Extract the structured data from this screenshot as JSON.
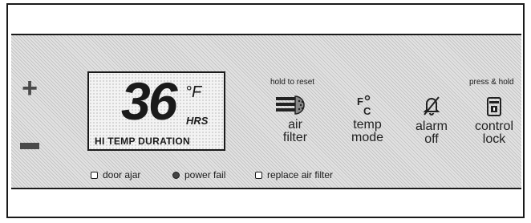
{
  "adjust": {
    "plus": "+"
  },
  "display": {
    "temperature": "36",
    "unit": "°F",
    "hours_unit": "HRS",
    "mode_label": "HI TEMP DURATION"
  },
  "controls": {
    "hold_to_reset": "hold to reset",
    "press_and_hold": "press & hold",
    "air_filter": {
      "line1": "air",
      "line2": "filter",
      "icon": "air-filter-icon"
    },
    "temp_mode": {
      "line1": "temp",
      "line2": "mode",
      "icon": "fahrenheit-celsius-icon"
    },
    "alarm_off": {
      "line1": "alarm",
      "line2": "off",
      "icon": "bell-slash-icon"
    },
    "control_lock": {
      "line1": "control",
      "line2": "lock",
      "icon": "lock-icon"
    }
  },
  "indicators": [
    {
      "label": "door ajar",
      "lit": false
    },
    {
      "label": "power fail",
      "lit": true
    },
    {
      "label": "replace air filter",
      "lit": false
    }
  ]
}
